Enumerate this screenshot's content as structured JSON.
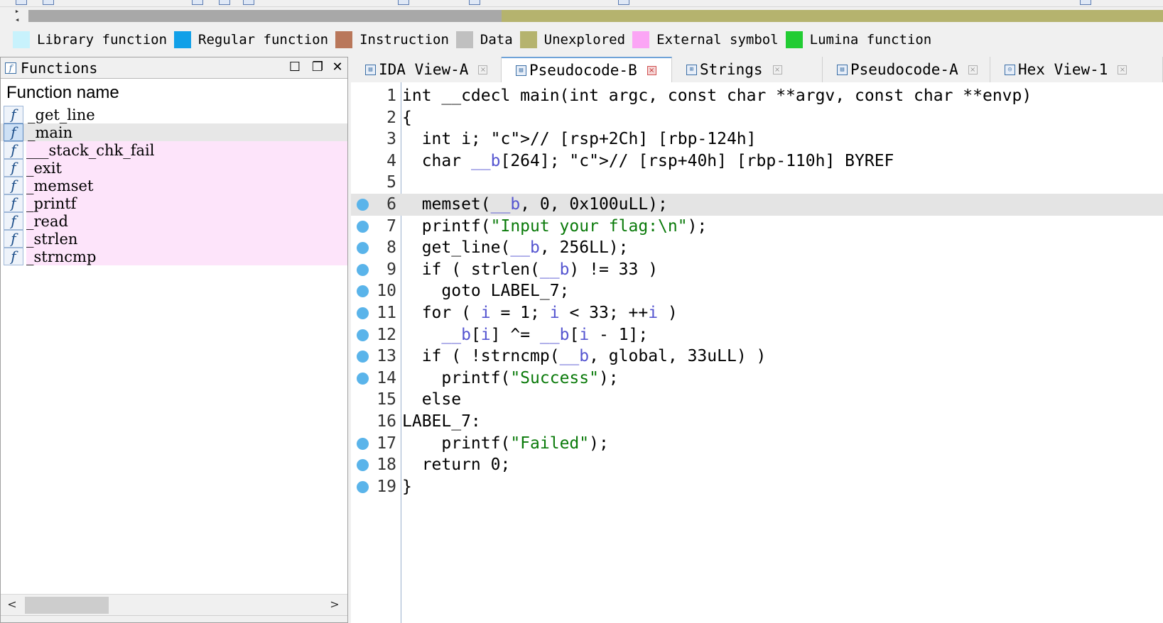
{
  "legend": [
    {
      "label": "Library function",
      "color": "#c8f2fc"
    },
    {
      "label": "Regular function",
      "color": "#11a0e8"
    },
    {
      "label": "Instruction",
      "color": "#b9775a"
    },
    {
      "label": "Data",
      "color": "#c0c0c0"
    },
    {
      "label": "Unexplored",
      "color": "#b5b36e"
    },
    {
      "label": "External symbol",
      "color": "#fba5f5"
    },
    {
      "label": "Lumina function",
      "color": "#22cc33"
    }
  ],
  "functions_panel": {
    "title": "Functions",
    "column_header": "Function name",
    "selected": "_main",
    "items": [
      {
        "name": "_get_line",
        "kind": "regular"
      },
      {
        "name": "_main",
        "kind": "regular"
      },
      {
        "name": "___stack_chk_fail",
        "kind": "external"
      },
      {
        "name": "_exit",
        "kind": "external"
      },
      {
        "name": "_memset",
        "kind": "external"
      },
      {
        "name": "_printf",
        "kind": "external"
      },
      {
        "name": "_read",
        "kind": "external"
      },
      {
        "name": "_strlen",
        "kind": "external"
      },
      {
        "name": "_strncmp",
        "kind": "external"
      }
    ]
  },
  "tabs": [
    {
      "label": "IDA View-A",
      "active": false
    },
    {
      "label": "Pseudocode-B",
      "active": true
    },
    {
      "label": "Strings",
      "active": false
    },
    {
      "label": "Pseudocode-A",
      "active": false
    },
    {
      "label": "Hex View-1",
      "active": false
    }
  ],
  "code": {
    "highlighted_line": 6,
    "lines": [
      {
        "n": "1",
        "bp": false,
        "text": "int __cdecl main(int argc, const char **argv, const char **envp)"
      },
      {
        "n": "2",
        "bp": false,
        "text": "{"
      },
      {
        "n": "3",
        "bp": false,
        "text": "  int i; // [rsp+2Ch] [rbp-124h]"
      },
      {
        "n": "4",
        "bp": false,
        "text": "  char __b[264]; // [rsp+40h] [rbp-110h] BYREF"
      },
      {
        "n": "5",
        "bp": false,
        "text": ""
      },
      {
        "n": "6",
        "bp": true,
        "text": "  memset(__b, 0, 0x100uLL);"
      },
      {
        "n": "7",
        "bp": true,
        "text": "  printf(\"Input your flag:\\n\");"
      },
      {
        "n": "8",
        "bp": true,
        "text": "  get_line(__b, 256LL);"
      },
      {
        "n": "9",
        "bp": true,
        "text": "  if ( strlen(__b) != 33 )"
      },
      {
        "n": "10",
        "bp": true,
        "text": "    goto LABEL_7;"
      },
      {
        "n": "11",
        "bp": true,
        "text": "  for ( i = 1; i < 33; ++i )"
      },
      {
        "n": "12",
        "bp": true,
        "text": "    __b[i] ^= __b[i - 1];"
      },
      {
        "n": "13",
        "bp": true,
        "text": "  if ( !strncmp(__b, global, 33uLL) )"
      },
      {
        "n": "14",
        "bp": true,
        "text": "    printf(\"Success\");"
      },
      {
        "n": "15",
        "bp": false,
        "text": "  else"
      },
      {
        "n": "16",
        "bp": false,
        "text": "LABEL_7:"
      },
      {
        "n": "17",
        "bp": true,
        "text": "    printf(\"Failed\");"
      },
      {
        "n": "18",
        "bp": true,
        "text": "  return 0;"
      },
      {
        "n": "19",
        "bp": true,
        "text": "}"
      }
    ]
  }
}
